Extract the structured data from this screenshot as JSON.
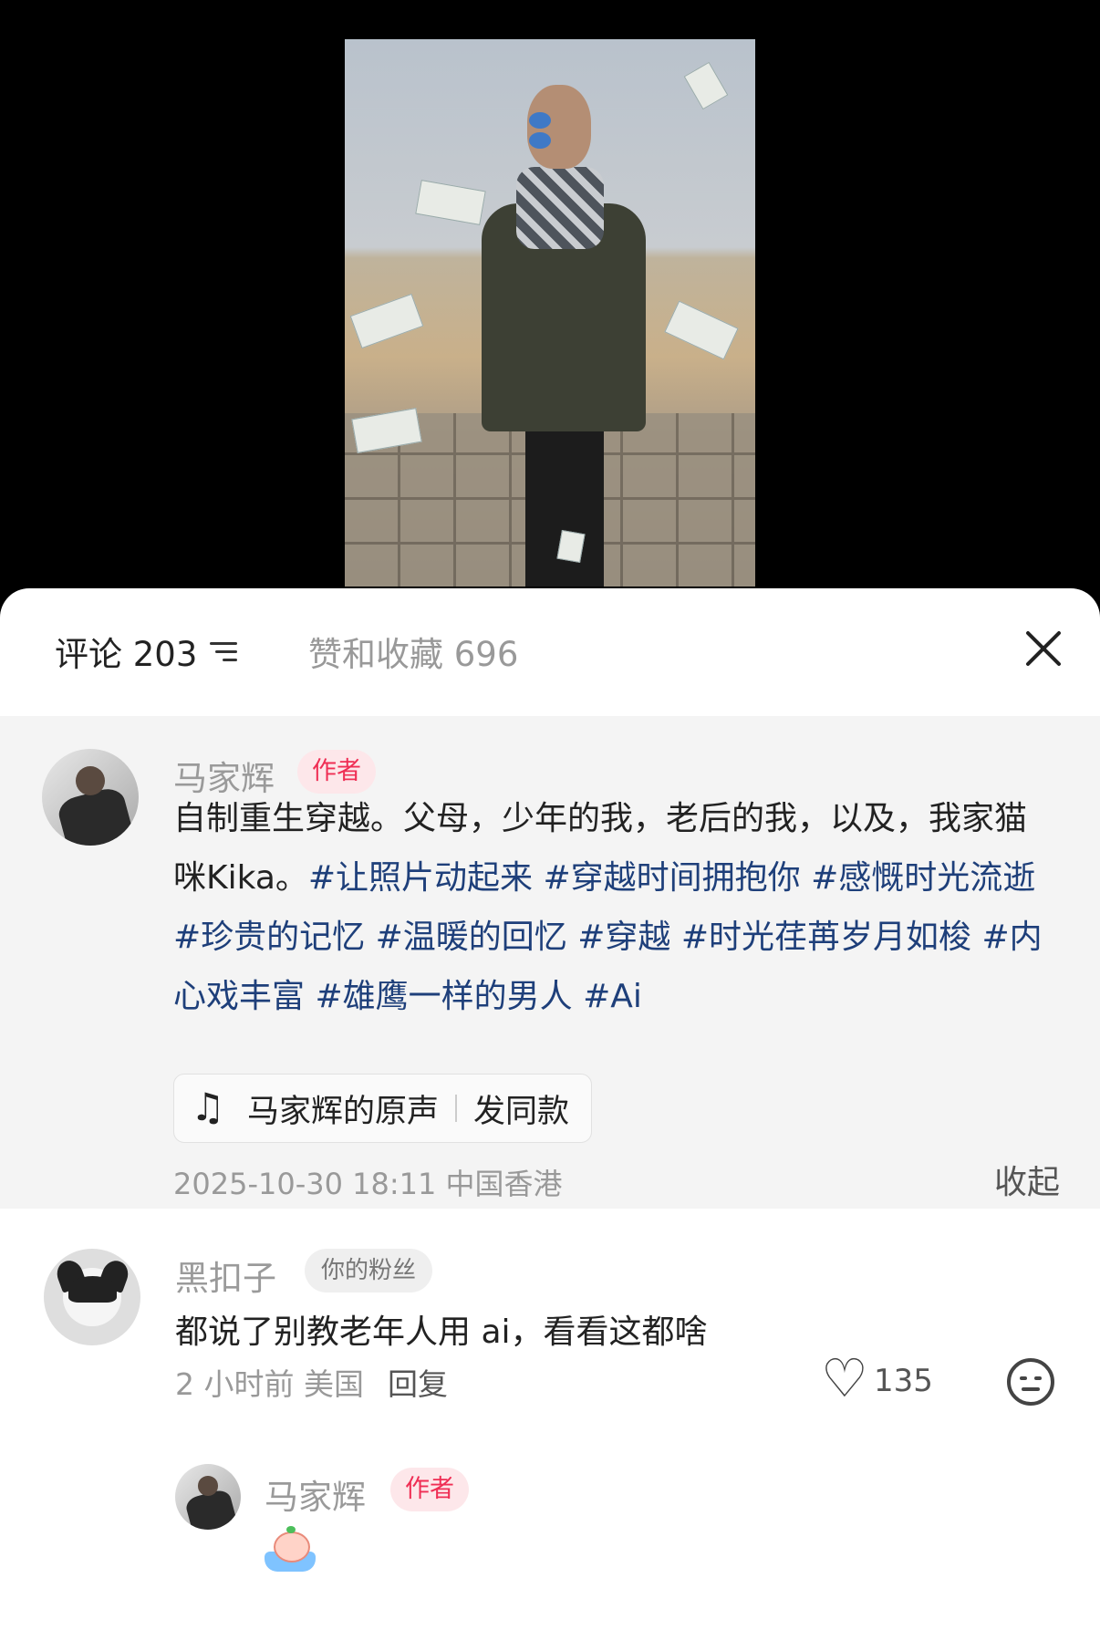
{
  "tabs": {
    "comments_label": "评论 203",
    "likes_label": "赞和收藏 696"
  },
  "post": {
    "author_name": "马家辉",
    "author_badge": "作者",
    "text_plain": "自制重生穿越。父母，少年的我，老后的我，以及，我家猫咪Kika。",
    "hashtags": [
      "#让照片动起来",
      "#穿越时间拥抱你",
      "#感慨时光流逝",
      "#珍贵的记忆",
      "#温暖的回忆",
      "#穿越",
      "#时光荏苒岁月如梭",
      "#内心戏丰富",
      "#雄鹰一样的男人",
      "#Ai"
    ],
    "music_title": "马家辉的原声",
    "music_action": "发同款",
    "meta": "2025-10-30 18:11 中国香港",
    "collapse_label": "收起"
  },
  "comments": [
    {
      "user": "黑扣子",
      "badge": "你的粉丝",
      "text": "都说了别教老年人用 ai，看看这都啥",
      "meta": "2 小时前 美国",
      "reply_label": "回复",
      "likes": "135"
    }
  ],
  "reply": {
    "user": "马家辉",
    "badge": "作者"
  },
  "icons": {
    "sort": "sort-icon",
    "close": "close-icon",
    "music": "music-note-icon",
    "like": "heart-icon",
    "emoji": "emoji-icon"
  },
  "colors": {
    "hashtag": "#1e3f7a",
    "author_badge_text": "#ef2e54",
    "author_badge_bg": "#fde7ea",
    "author_block_bg": "#f4f4f4"
  }
}
